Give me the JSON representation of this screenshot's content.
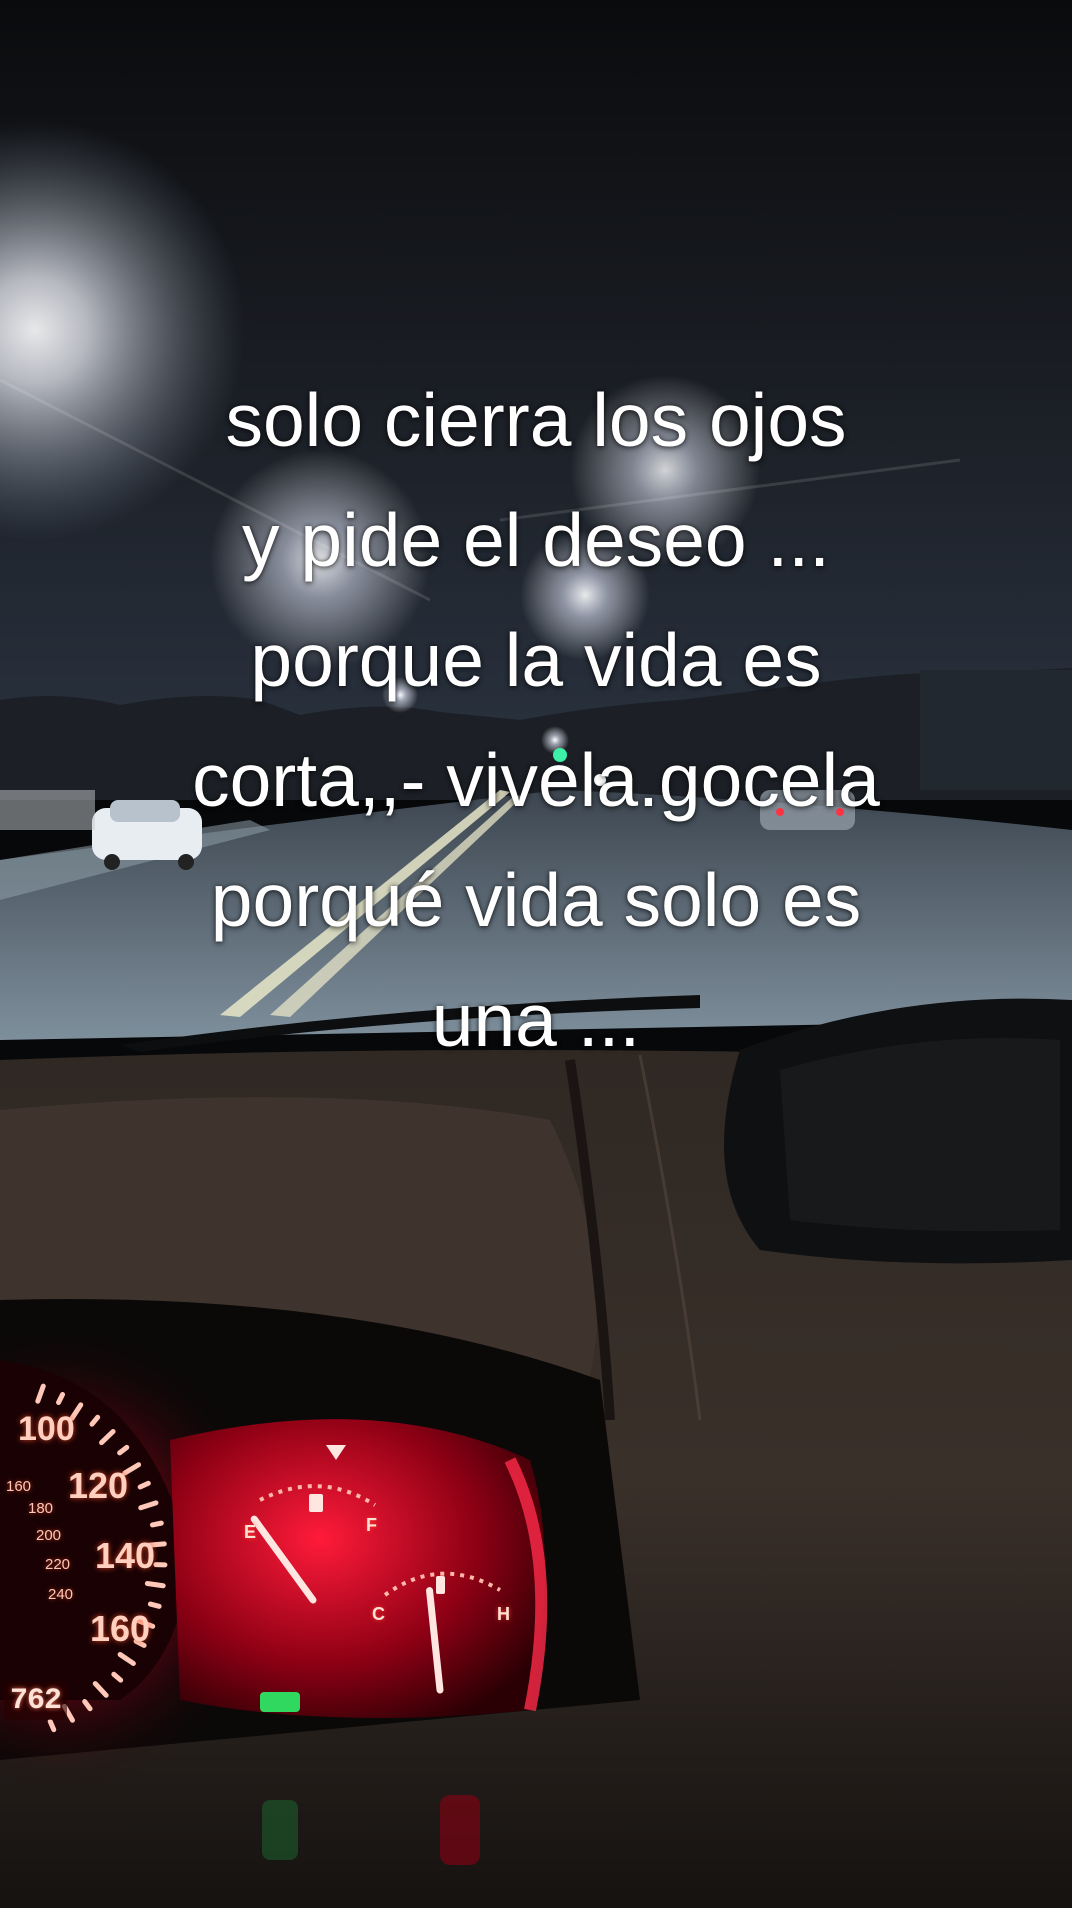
{
  "caption": {
    "lines": [
      "solo cierra los ojos",
      "y pide el deseo ...",
      "porque la vida es",
      "corta,,- vivela.gocela",
      "porqué vida solo es",
      "una ..."
    ]
  },
  "dashboard": {
    "speedometer_labels": [
      "100",
      "120",
      "140",
      "160"
    ],
    "speedometer_inner_labels": [
      "160",
      "180",
      "200",
      "220",
      "240"
    ],
    "fuel_gauge": {
      "empty_label": "E",
      "full_label": "F",
      "level": 0.2
    },
    "temp_gauge": {
      "cold_label": "C",
      "hot_label": "H",
      "level": 0.45
    },
    "odometer": "762"
  },
  "colors": {
    "sky": "#0b0d10",
    "road": "#5a6a78",
    "dash": "#2b2420",
    "cluster_red": "#ff1030",
    "caption_text": "#ffffff"
  }
}
